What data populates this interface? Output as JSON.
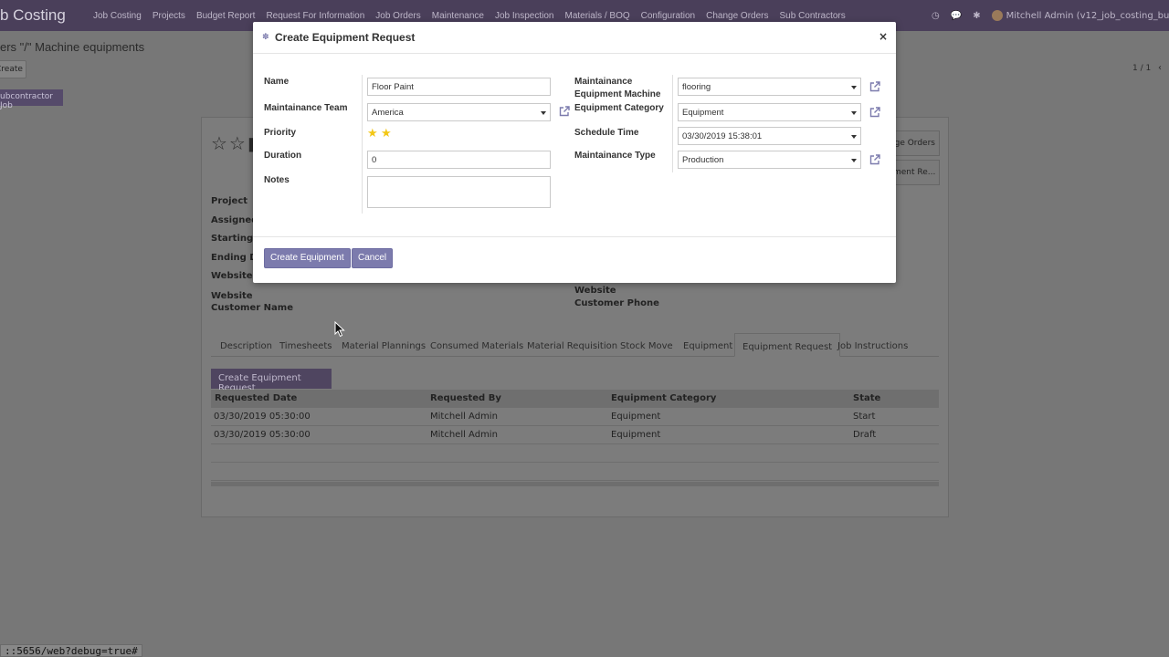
{
  "navbar": {
    "brand": "b Costing",
    "menu": [
      "Job Costing",
      "Projects",
      "Budget Report",
      "Request For Information",
      "Job Orders",
      "Maintenance",
      "Job Inspection",
      "Materials / BOQ",
      "Configuration",
      "Change Orders",
      "Sub Contractors"
    ],
    "user": "Mitchell Admin (v12_job_costing_bund"
  },
  "background": {
    "breadcrumb": "ers \"/\" Machine equipments",
    "create_label": "Create",
    "pager": "1 / 1",
    "subcontractor_button": "ubcontractor Job",
    "labels": {
      "project": "Project",
      "assigned": "Assigned T",
      "starting": "Starting Da",
      "ending": "Ending Da",
      "website_c": "Website C",
      "website_customer_name": "Website Customer Name",
      "website_customer_phone": "Website Customer Phone"
    },
    "right_buttons": [
      "ge Orders",
      "ment Re..."
    ],
    "tabs": [
      "Description",
      "Timesheets",
      "Material Plannings",
      "Consumed Materials",
      "Material Requisition",
      "Stock Move",
      "Equipment",
      "Equipment Request",
      "Job Instructions"
    ],
    "create_equipment_request": "Create Equipment Request",
    "table": {
      "headers": [
        "Requested Date",
        "Requested By",
        "Equipment Category",
        "State"
      ],
      "rows": [
        [
          "03/30/2019 05:30:00",
          "Mitchell Admin",
          "Equipment",
          "Start"
        ],
        [
          "03/30/2019 05:30:00",
          "Mitchell Admin",
          "Equipment",
          "Draft"
        ]
      ]
    },
    "status_url": "::5656/web?debug=true#"
  },
  "modal": {
    "title": "Create Equipment Request",
    "close": "×",
    "left": {
      "name_label": "Name",
      "name_value": "Floor Paint",
      "team_label": "Maintainance Team",
      "team_value": "America",
      "priority_label": "Priority",
      "priority_stars": 2,
      "duration_label": "Duration",
      "duration_value": "0",
      "notes_label": "Notes"
    },
    "right": {
      "machine_label": "Maintainance Equipment Machine",
      "machine_value": "flooring",
      "category_label": "Equipment Category",
      "category_value": "Equipment",
      "schedule_label": "Schedule Time",
      "schedule_value": "03/30/2019 15:38:01",
      "type_label": "Maintainance Type",
      "type_value": "Production"
    },
    "buttons": {
      "create": "Create Equipment",
      "cancel": "Cancel"
    }
  },
  "colors": {
    "primary": "#7c7bad",
    "navbar": "#4a3f5a",
    "star": "#f3c716"
  }
}
